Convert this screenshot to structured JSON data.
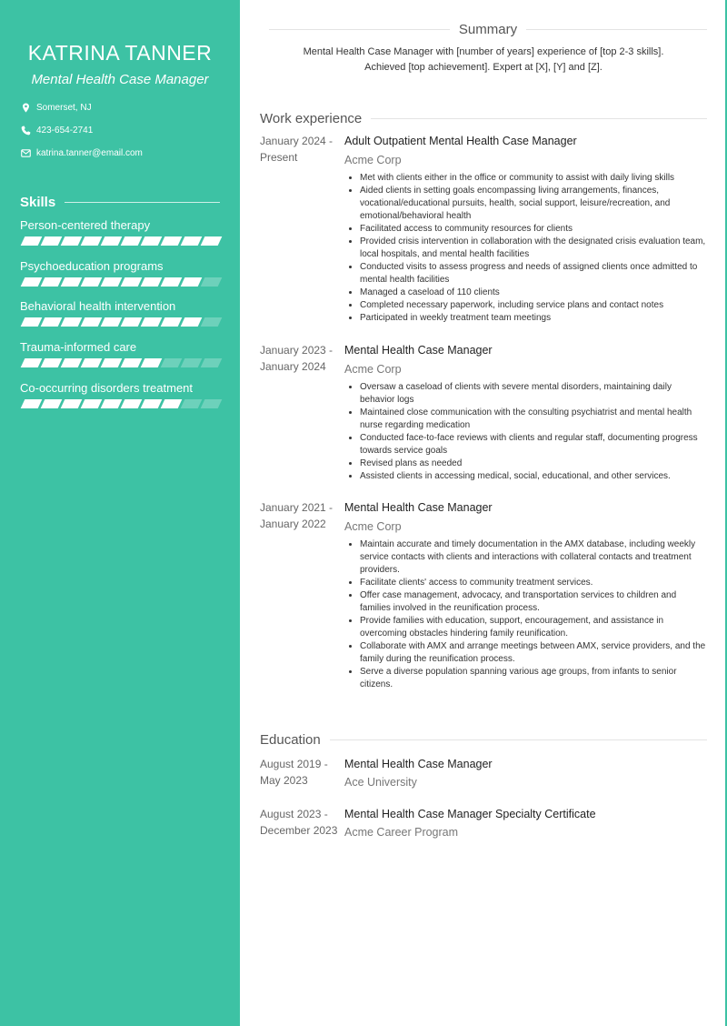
{
  "profile": {
    "name": "KATRINA TANNER",
    "title": "Mental Health Case Manager",
    "contacts": [
      {
        "icon": "location-pin-icon",
        "text": "Somerset, NJ"
      },
      {
        "icon": "phone-icon",
        "text": "423-654-2741"
      },
      {
        "icon": "email-icon",
        "text": "katrina.tanner@email.com"
      }
    ]
  },
  "skills": {
    "heading": "Skills",
    "max_level": 10,
    "items": [
      {
        "label": "Person-centered therapy",
        "level": 10
      },
      {
        "label": "Psychoeducation programs",
        "level": 9
      },
      {
        "label": "Behavioral health intervention",
        "level": 9
      },
      {
        "label": "Trauma-informed care",
        "level": 7
      },
      {
        "label": "Co-occurring disorders treatment",
        "level": 8
      }
    ]
  },
  "summary": {
    "heading": "Summary",
    "line1": "Mental Health Case Manager with [number of years] experience of [top 2-3 skills].",
    "line2": "Achieved [top achievement]. Expert at [X], [Y] and [Z]."
  },
  "work": {
    "heading": "Work experience",
    "entries": [
      {
        "date_start": "January 2024 -",
        "date_end": "Present",
        "role": "Adult Outpatient Mental Health Case Manager",
        "org": "Acme Corp",
        "bullets": [
          "Met with clients either in the office or community to assist with daily living skills",
          "Aided clients in setting goals encompassing living arrangements, finances, vocational/educational pursuits, health, social support, leisure/recreation, and emotional/behavioral health",
          "Facilitated access to community resources for clients",
          "Provided crisis intervention in collaboration with the designated crisis evaluation team, local hospitals, and mental health facilities",
          "Conducted visits to assess progress and needs of assigned clients once admitted to mental health facilities",
          "Managed a caseload of 110 clients",
          "Completed necessary paperwork, including service plans and contact notes",
          "Participated in weekly treatment team meetings"
        ]
      },
      {
        "date_start": "January 2023 -",
        "date_end": "January 2024",
        "role": "Mental Health Case Manager",
        "org": "Acme Corp",
        "bullets": [
          "Oversaw a caseload of clients with severe mental disorders, maintaining daily behavior logs",
          "Maintained close communication with the consulting psychiatrist and mental health nurse regarding medication",
          "Conducted face-to-face reviews with clients and regular staff, documenting progress towards service goals",
          "Revised plans as needed",
          "Assisted clients in accessing medical, social, educational, and other services."
        ]
      },
      {
        "date_start": "January 2021 -",
        "date_end": "January 2022",
        "role": "Mental Health Case Manager",
        "org": "Acme Corp",
        "bullets": [
          "Maintain accurate and timely documentation in the AMX database, including weekly service contacts with clients and interactions with collateral contacts and treatment providers.",
          "Facilitate clients' access to community treatment services.",
          "Offer case management, advocacy, and transportation services to children and families involved in the reunification process.",
          "Provide families with education, support, encouragement, and assistance in overcoming obstacles hindering family reunification.",
          "Collaborate with AMX and arrange meetings between AMX, service providers, and the family during the reunification process.",
          "Serve a diverse population spanning various age groups, from infants to senior citizens."
        ]
      }
    ]
  },
  "education": {
    "heading": "Education",
    "entries": [
      {
        "date_start": "August 2019 -",
        "date_end": "May 2023",
        "role": "Mental Health Case Manager",
        "org": "Ace University"
      },
      {
        "date_start": "August 2023 -",
        "date_end": "December 2023",
        "role": "Mental Health Case Manager Specialty Certificate",
        "org": "Acme Career Program"
      }
    ]
  },
  "colors": {
    "accent": "#3dc2a4",
    "text": "#333333",
    "muted": "#777777"
  }
}
